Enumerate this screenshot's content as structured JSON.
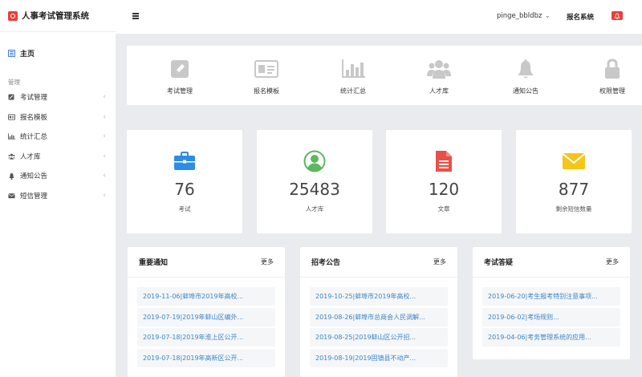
{
  "app": {
    "title": "人事考试管理系统"
  },
  "sidebar": {
    "home": "主页",
    "section": "管理",
    "items": [
      {
        "label": "考试管理",
        "icon": "edit-icon"
      },
      {
        "label": "报名模板",
        "icon": "id-card-icon"
      },
      {
        "label": "统计汇总",
        "icon": "bar-chart-icon"
      },
      {
        "label": "人才库",
        "icon": "users-icon"
      },
      {
        "label": "通知公告",
        "icon": "bell-icon"
      },
      {
        "label": "短信管理",
        "icon": "envelope-icon"
      }
    ]
  },
  "topbar": {
    "user": "pinge_bbldbz",
    "system_link": "报名系统"
  },
  "quick_links": [
    {
      "label": "考试管理",
      "icon": "edit-icon"
    },
    {
      "label": "报名模板",
      "icon": "id-card-icon"
    },
    {
      "label": "统计汇总",
      "icon": "bar-chart-icon"
    },
    {
      "label": "人才库",
      "icon": "users-icon"
    },
    {
      "label": "通知公告",
      "icon": "bell-icon"
    },
    {
      "label": "权限管理",
      "icon": "lock-icon"
    }
  ],
  "stats": [
    {
      "value": "76",
      "label": "考试",
      "icon": "briefcase-icon",
      "color": "#2d8ce6"
    },
    {
      "value": "25483",
      "label": "人才库",
      "icon": "user-circle-icon",
      "color": "#5cb85c"
    },
    {
      "value": "120",
      "label": "文章",
      "icon": "document-icon",
      "color": "#e8504a"
    },
    {
      "value": "877",
      "label": "剩余短信数量",
      "icon": "envelope-icon",
      "color": "#f5c518"
    }
  ],
  "panels": [
    {
      "title": "重要通知",
      "more": "更多",
      "rows": [
        "2019-11-06|蚌埠市2019年高校...",
        "2019-07-19|2019年蚌山区编外...",
        "2019-07-18|2019年淮上区公开...",
        "2019-07-18|2019年高新区公开..."
      ]
    },
    {
      "title": "招考公告",
      "more": "更多",
      "rows": [
        "2019-10-25|蚌埠市2019年高校...",
        "2019-08-26|蚌埠市总商会人民调解...",
        "2019-08-25|2019蚌山区公开招...",
        "2019-08-19|2019固镇县不动产..."
      ]
    },
    {
      "title": "考试答疑",
      "more": "更多",
      "rows": [
        "2019-06-20|考生报考特别注意事项...",
        "2019-06-02|考场规则...",
        "2019-04-06|考务管理系统的应用..."
      ]
    }
  ]
}
